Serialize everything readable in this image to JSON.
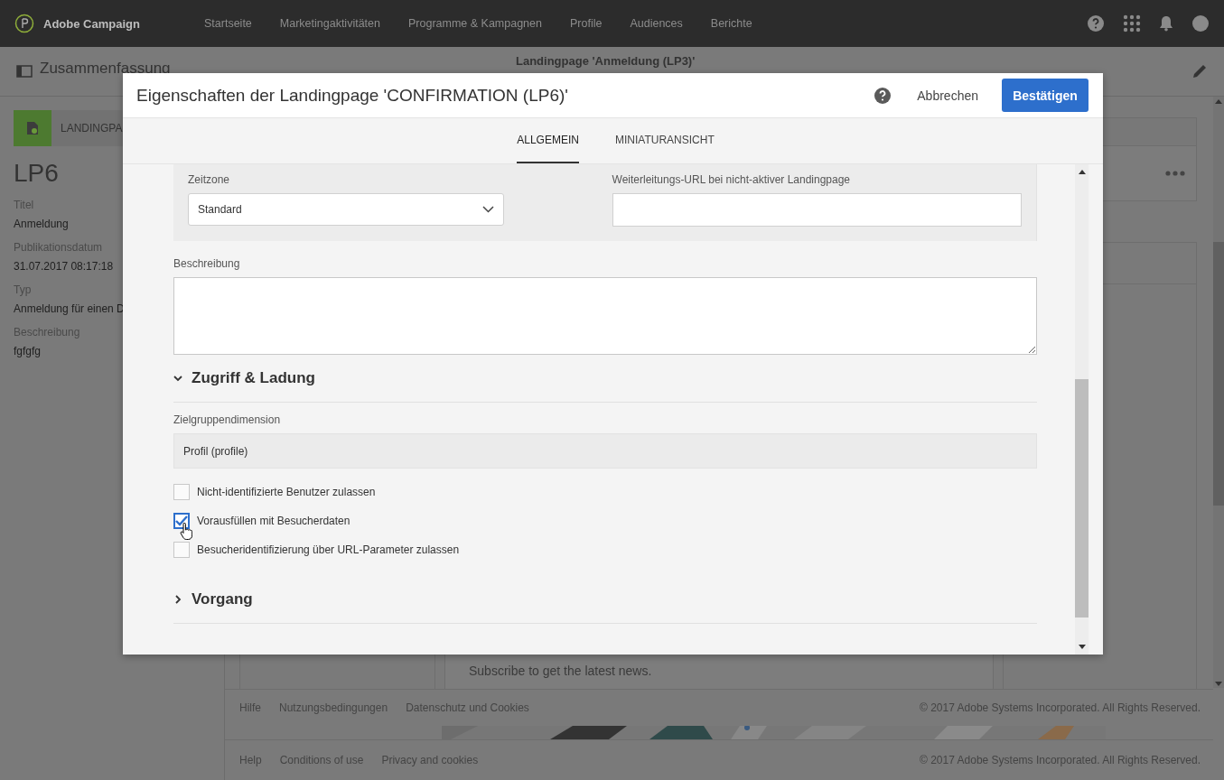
{
  "app": {
    "name": "Adobe Campaign"
  },
  "nav": [
    {
      "label": "Startseite"
    },
    {
      "label": "Marketingaktivitäten"
    },
    {
      "label": "Programme & Kampagnen"
    },
    {
      "label": "Profile"
    },
    {
      "label": "Audiences"
    },
    {
      "label": "Berichte"
    }
  ],
  "subheader": {
    "title": "Zusammenfassung",
    "center": "Landingpage 'Anmeldung (LP3)'"
  },
  "summary": {
    "badge": "LANDINGPA",
    "name": "LP6",
    "fields": [
      {
        "label": "Titel",
        "value": "Anmeldung"
      },
      {
        "label": "Publikationsdatum",
        "value": "31.07.2017 08:17:18"
      },
      {
        "label": "Typ",
        "value": "Anmeldung für einen D"
      },
      {
        "label": "Beschreibung",
        "value": "fgfgfg"
      }
    ]
  },
  "background": {
    "teaser": "Subscribe to get the latest news."
  },
  "footers": [
    {
      "links": [
        "Hilfe",
        "Nutzungsbedingungen",
        "Datenschutz und Cookies"
      ],
      "copyright": "© 2017 Adobe Systems Incorporated. All Rights Reserved."
    },
    {
      "links": [
        "Help",
        "Conditions of use",
        "Privacy and cookies"
      ],
      "copyright": "© 2017 Adobe Systems Incorporated. All Rights Reserved."
    }
  ],
  "dialog": {
    "title": "Eigenschaften der Landingpage 'CONFIRMATION (LP6)'",
    "cancel": "Abbrechen",
    "confirm": "Bestätigen",
    "tabs": [
      {
        "label": "ALLGEMEIN",
        "selected": true
      },
      {
        "label": "MINIATURANSICHT",
        "selected": false
      }
    ],
    "timezone": {
      "label": "Zeitzone",
      "value": "Standard"
    },
    "redirect": {
      "label": "Weiterleitungs-URL bei nicht-aktiver Landingpage"
    },
    "description": {
      "label": "Beschreibung"
    },
    "sections": [
      {
        "title": "Zugriff & Ladung",
        "expanded": true
      },
      {
        "title": "Vorgang",
        "expanded": false
      }
    ],
    "audience": {
      "label": "Zielgruppendimension",
      "value": "Profil (profile)"
    },
    "options": [
      {
        "label": "Nicht-identifizierte Benutzer zulassen",
        "checked": false
      },
      {
        "label": "Vorausfüllen mit Besucherdaten",
        "checked": true
      },
      {
        "label": "Besucheridentifizierung über URL-Parameter zulassen",
        "checked": false
      }
    ]
  }
}
